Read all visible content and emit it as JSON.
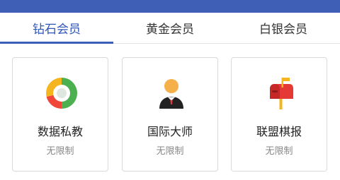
{
  "tabs": [
    {
      "label": "钻石会员",
      "active": true
    },
    {
      "label": "黄金会员",
      "active": false
    },
    {
      "label": "白银会员",
      "active": false
    }
  ],
  "cards": [
    {
      "title": "数据私教",
      "subtitle": "无限制",
      "icon": "pie-chart-icon"
    },
    {
      "title": "国际大师",
      "subtitle": "无限制",
      "icon": "master-avatar-icon"
    },
    {
      "title": "联盟棋报",
      "subtitle": "无限制",
      "icon": "mailbox-icon"
    }
  ],
  "colors": {
    "header": "#3f5fb6",
    "active_tab": "#2f56b9",
    "underline": "#3b5cb8"
  }
}
